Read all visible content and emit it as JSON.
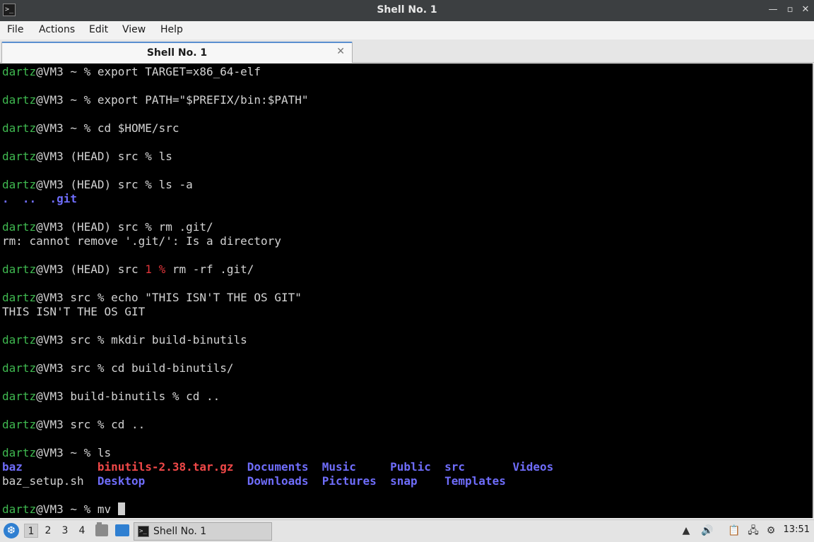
{
  "window": {
    "title": "Shell No. 1",
    "icon": "terminal-icon"
  },
  "menu": {
    "items": [
      "File",
      "Actions",
      "Edit",
      "View",
      "Help"
    ]
  },
  "tabs": [
    {
      "label": "Shell No. 1"
    }
  ],
  "terminal": {
    "lines": [
      [
        {
          "t": "dartz",
          "c": "g"
        },
        {
          "t": "@VM3 ~ % export TARGET=x86_64-elf",
          "c": "w"
        }
      ],
      [],
      [
        {
          "t": "dartz",
          "c": "g"
        },
        {
          "t": "@VM3 ~ % export PATH=\"$PREFIX/bin:$PATH\"",
          "c": "w"
        }
      ],
      [],
      [
        {
          "t": "dartz",
          "c": "g"
        },
        {
          "t": "@VM3 ~ % cd $HOME/src",
          "c": "w"
        }
      ],
      [],
      [
        {
          "t": "dartz",
          "c": "g"
        },
        {
          "t": "@VM3 (HEAD) src % ls",
          "c": "w"
        }
      ],
      [],
      [
        {
          "t": "dartz",
          "c": "g"
        },
        {
          "t": "@VM3 (HEAD) src % ls -a",
          "c": "w"
        }
      ],
      [
        {
          "t": ".  ..  .git",
          "c": "b"
        }
      ],
      [],
      [
        {
          "t": "dartz",
          "c": "g"
        },
        {
          "t": "@VM3 (HEAD) src % rm .git/",
          "c": "w"
        }
      ],
      [
        {
          "t": "rm: cannot remove '.git/': Is a directory",
          "c": "w"
        }
      ],
      [],
      [
        {
          "t": "dartz",
          "c": "g"
        },
        {
          "t": "@VM3 (HEAD) src ",
          "c": "w"
        },
        {
          "t": "1 %",
          "c": "r"
        },
        {
          "t": " rm -rf .git/",
          "c": "w"
        }
      ],
      [],
      [
        {
          "t": "dartz",
          "c": "g"
        },
        {
          "t": "@VM3 src % echo \"THIS ISN'T THE OS GIT\"",
          "c": "w"
        }
      ],
      [
        {
          "t": "THIS ISN'T THE OS GIT",
          "c": "w"
        }
      ],
      [],
      [
        {
          "t": "dartz",
          "c": "g"
        },
        {
          "t": "@VM3 src % mkdir build-binutils",
          "c": "w"
        }
      ],
      [],
      [
        {
          "t": "dartz",
          "c": "g"
        },
        {
          "t": "@VM3 src % cd build-binutils/",
          "c": "w"
        }
      ],
      [],
      [
        {
          "t": "dartz",
          "c": "g"
        },
        {
          "t": "@VM3 build-binutils % cd ..",
          "c": "w"
        }
      ],
      [],
      [
        {
          "t": "dartz",
          "c": "g"
        },
        {
          "t": "@VM3 src % cd ..",
          "c": "w"
        }
      ],
      [],
      [
        {
          "t": "dartz",
          "c": "g"
        },
        {
          "t": "@VM3 ~ % ls",
          "c": "w"
        }
      ],
      [
        {
          "t": "baz           ",
          "c": "b"
        },
        {
          "t": "binutils-2.38.tar.gz",
          "c": "rb"
        },
        {
          "t": "  ",
          "c": "w"
        },
        {
          "t": "Documents  Music     Public  src       Videos",
          "c": "b"
        }
      ],
      [
        {
          "t": "baz_setup.sh  ",
          "c": "w"
        },
        {
          "t": "Desktop               Downloads  Pictures  snap    Templates",
          "c": "b"
        }
      ],
      [],
      [
        {
          "t": "dartz",
          "c": "g"
        },
        {
          "t": "@VM3 ~ % mv ",
          "c": "w"
        },
        {
          "t": "",
          "c": "cursor"
        }
      ]
    ]
  },
  "taskbar": {
    "start_icon": "start-menu-icon",
    "workspaces": [
      "1",
      "2",
      "3",
      "4"
    ],
    "active_workspace": "1",
    "task_label": "Shell No. 1",
    "clock": "13:51"
  },
  "colors": {
    "prompt_user": "#3fb950",
    "directory": "#6f6dfb",
    "archive": "#f04848",
    "error_code": "#e0353a"
  }
}
